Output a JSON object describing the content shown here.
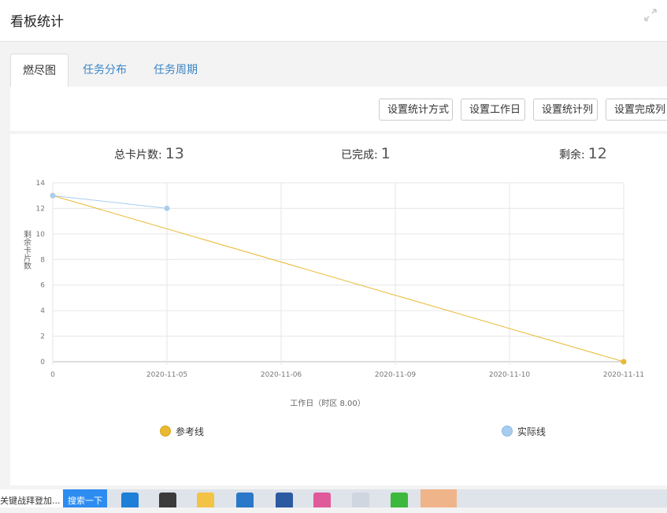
{
  "header": {
    "title": "看板统计",
    "expand_icon": "expand-icon"
  },
  "tabs": [
    {
      "label": "燃尽图",
      "active": true
    },
    {
      "label": "任务分布",
      "active": false
    },
    {
      "label": "任务周期",
      "active": false
    }
  ],
  "toolbar": {
    "buttons": [
      "设置统计方式",
      "设置工作日",
      "设置统计列",
      "设置完成列"
    ]
  },
  "stats": {
    "total_label": "总卡片数:",
    "total_value": "13",
    "done_label": "已完成:",
    "done_value": "1",
    "remaining_label": "剩余:",
    "remaining_value": "12"
  },
  "chart_data": {
    "type": "line",
    "xlabel": "工作日（时区 8.00）",
    "ylabel": "剩余卡片数",
    "categories": [
      "0",
      "2020-11-05",
      "2020-11-06",
      "2020-11-09",
      "2020-11-10",
      "2020-11-11"
    ],
    "ylim": [
      0,
      14
    ],
    "yticks": [
      0,
      2,
      4,
      6,
      8,
      10,
      12,
      14
    ],
    "grid": true,
    "legend_position": "bottom",
    "series": [
      {
        "name": "参考线",
        "color": "#e8b931",
        "values": [
          13,
          null,
          null,
          null,
          null,
          0
        ]
      },
      {
        "name": "实际线",
        "color": "#a9cdee",
        "values": [
          13,
          12,
          null,
          null,
          null,
          null
        ]
      }
    ]
  },
  "taskbar": {
    "search_text": "关键战拜登加...",
    "search_button": "搜索一下",
    "icons": [
      "edge-icon",
      "store-icon",
      "folder-icon",
      "mail-icon",
      "powershell-icon",
      "photos-icon",
      "file-icon",
      "wechat-icon",
      "iqiyi-icon"
    ]
  }
}
